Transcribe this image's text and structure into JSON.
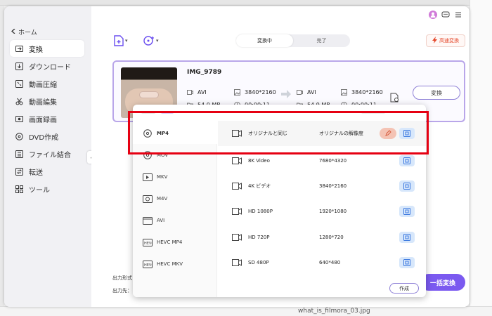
{
  "background": {
    "bottom_file": "what_is_filmora_03.jpg"
  },
  "sidebar": {
    "back_label": "ホーム",
    "items": [
      {
        "label": "変換",
        "icon": "convert-icon",
        "active": true
      },
      {
        "label": "ダウンロード",
        "icon": "download-icon"
      },
      {
        "label": "動画圧縮",
        "icon": "compress-icon"
      },
      {
        "label": "動画編集",
        "icon": "scissors-icon"
      },
      {
        "label": "画面録画",
        "icon": "record-icon"
      },
      {
        "label": "DVD作成",
        "icon": "disc-icon"
      },
      {
        "label": "ファイル結合",
        "icon": "merge-icon"
      },
      {
        "label": "転送",
        "icon": "transfer-icon"
      },
      {
        "label": "ツール",
        "icon": "grid-icon"
      }
    ]
  },
  "toolbar": {
    "tabs": [
      {
        "label": "変換中",
        "active": true
      },
      {
        "label": "完了"
      }
    ],
    "high_speed_label": "高速変換"
  },
  "file": {
    "name": "IMG_9789",
    "source": {
      "format": "AVI",
      "resolution": "3840*2160",
      "size": "54.0 MB",
      "duration": "00:00:11"
    },
    "target": {
      "format": "AVI",
      "resolution": "3840*2160",
      "size": "54.9 MB",
      "duration": "00:00:11"
    },
    "convert_label": "変換"
  },
  "footer": {
    "output_format_label": "出力形式",
    "output_dest_label": "出力先：",
    "bulk_convert_label": "一括変換"
  },
  "format_popup": {
    "formats": [
      {
        "label": "MP4",
        "icon": "disc-icon",
        "selected": true
      },
      {
        "label": "MOV",
        "icon": "disc-icon"
      },
      {
        "label": "MKV",
        "icon": "video-icon"
      },
      {
        "label": "M4V",
        "icon": "video-icon"
      },
      {
        "label": "AVI",
        "icon": "film-icon"
      },
      {
        "label": "HEVC MP4",
        "icon": "hevc-icon"
      },
      {
        "label": "HEVC MKV",
        "icon": "hevc-icon"
      }
    ],
    "resolutions": [
      {
        "name": "オリジナルと同じ",
        "value": "オリジナルの解像度",
        "selected": true
      },
      {
        "name": "8K Video",
        "value": "7680*4320"
      },
      {
        "name": "4K ビデオ",
        "value": "3840*2160"
      },
      {
        "name": "HD 1080P",
        "value": "1920*1080"
      },
      {
        "name": "HD 720P",
        "value": "1280*720"
      },
      {
        "name": "SD 480P",
        "value": "640*480"
      }
    ],
    "create_label": "作成"
  },
  "colors": {
    "accent": "#7b5af0",
    "highlight_box": "#e60012",
    "high_speed": "#e5482b",
    "card_border": "#b9a6e9"
  }
}
